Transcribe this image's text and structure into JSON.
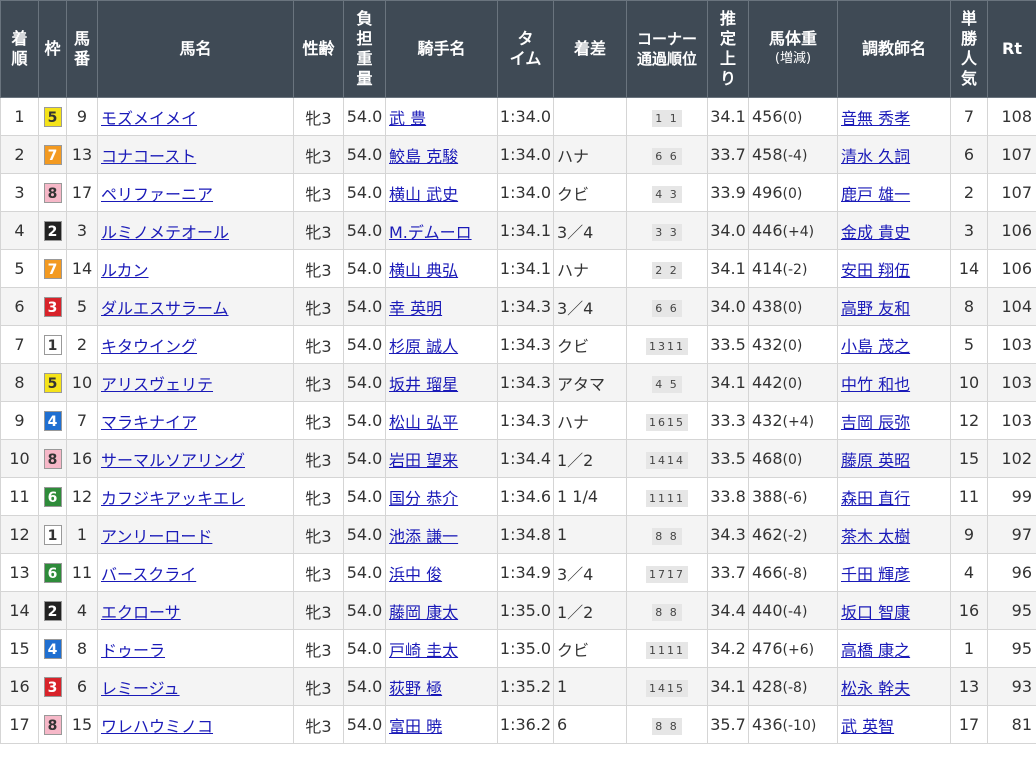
{
  "header": {
    "finish": "着順",
    "waku": "枠",
    "umaban": "馬番",
    "horse": "馬名",
    "sexage": "性齢",
    "weight": "負担重量",
    "jockey": "騎手名",
    "time": "タイム",
    "margin": "着差",
    "corner": "コーナー通過順位",
    "last3f": "推定上り",
    "body": "馬体重",
    "body_sub": "(増減)",
    "trainer": "調教師名",
    "pop": "単勝人気",
    "rt": "Rt"
  },
  "colors": {
    "1": {
      "bg": "#ffffff",
      "fg": "#333333"
    },
    "2": {
      "bg": "#222222",
      "fg": "#ffffff"
    },
    "3": {
      "bg": "#d8232a",
      "fg": "#ffffff"
    },
    "4": {
      "bg": "#1f6fd1",
      "fg": "#ffffff"
    },
    "5": {
      "bg": "#f5e31a",
      "fg": "#333333"
    },
    "6": {
      "bg": "#2e8b3a",
      "fg": "#ffffff"
    },
    "7": {
      "bg": "#f39a21",
      "fg": "#ffffff"
    },
    "8": {
      "bg": "#f6b8c8",
      "fg": "#333333"
    }
  },
  "rows": [
    {
      "finish": "1",
      "waku": "5",
      "umaban": "9",
      "horse": "モズメイメイ",
      "sexage": "牝3",
      "weight": "54.0",
      "jockey": "武 豊",
      "time": "1:34.0",
      "margin": "",
      "corner": "1 1",
      "last3f": "34.1",
      "body": "456",
      "diff": "(0)",
      "trainer": "音無 秀孝",
      "pop": "7",
      "rt": "108"
    },
    {
      "finish": "2",
      "waku": "7",
      "umaban": "13",
      "horse": "コナコースト",
      "sexage": "牝3",
      "weight": "54.0",
      "jockey": "鮫島 克駿",
      "time": "1:34.0",
      "margin": "ハナ",
      "corner": "6 6",
      "last3f": "33.7",
      "body": "458",
      "diff": "(-4)",
      "trainer": "清水 久詞",
      "pop": "6",
      "rt": "107"
    },
    {
      "finish": "3",
      "waku": "8",
      "umaban": "17",
      "horse": "ペリファーニア",
      "sexage": "牝3",
      "weight": "54.0",
      "jockey": "横山 武史",
      "time": "1:34.0",
      "margin": "クビ",
      "corner": "4 3",
      "last3f": "33.9",
      "body": "496",
      "diff": "(0)",
      "trainer": "鹿戸 雄一",
      "pop": "2",
      "rt": "107"
    },
    {
      "finish": "4",
      "waku": "2",
      "umaban": "3",
      "horse": "ルミノメテオール",
      "sexage": "牝3",
      "weight": "54.0",
      "jockey": "M.デムーロ",
      "time": "1:34.1",
      "margin": "3／4",
      "corner": "3 3",
      "last3f": "34.0",
      "body": "446",
      "diff": "(+4)",
      "trainer": "金成 貴史",
      "pop": "3",
      "rt": "106"
    },
    {
      "finish": "5",
      "waku": "7",
      "umaban": "14",
      "horse": "ルカン",
      "sexage": "牝3",
      "weight": "54.0",
      "jockey": "横山 典弘",
      "time": "1:34.1",
      "margin": "ハナ",
      "corner": "2 2",
      "last3f": "34.1",
      "body": "414",
      "diff": "(-2)",
      "trainer": "安田 翔伍",
      "pop": "14",
      "rt": "106"
    },
    {
      "finish": "6",
      "waku": "3",
      "umaban": "5",
      "horse": "ダルエスサラーム",
      "sexage": "牝3",
      "weight": "54.0",
      "jockey": "幸 英明",
      "time": "1:34.3",
      "margin": "3／4",
      "corner": "6 6",
      "last3f": "34.0",
      "body": "438",
      "diff": "(0)",
      "trainer": "高野 友和",
      "pop": "8",
      "rt": "104"
    },
    {
      "finish": "7",
      "waku": "1",
      "umaban": "2",
      "horse": "キタウイング",
      "sexage": "牝3",
      "weight": "54.0",
      "jockey": "杉原 誠人",
      "time": "1:34.3",
      "margin": "クビ",
      "corner": "1311",
      "last3f": "33.5",
      "body": "432",
      "diff": "(0)",
      "trainer": "小島 茂之",
      "pop": "5",
      "rt": "103"
    },
    {
      "finish": "8",
      "waku": "5",
      "umaban": "10",
      "horse": "アリスヴェリテ",
      "sexage": "牝3",
      "weight": "54.0",
      "jockey": "坂井 瑠星",
      "time": "1:34.3",
      "margin": "アタマ",
      "corner": "4 5",
      "last3f": "34.1",
      "body": "442",
      "diff": "(0)",
      "trainer": "中竹 和也",
      "pop": "10",
      "rt": "103"
    },
    {
      "finish": "9",
      "waku": "4",
      "umaban": "7",
      "horse": "マラキナイア",
      "sexage": "牝3",
      "weight": "54.0",
      "jockey": "松山 弘平",
      "time": "1:34.3",
      "margin": "ハナ",
      "corner": "1615",
      "last3f": "33.3",
      "body": "432",
      "diff": "(+4)",
      "trainer": "吉岡 辰弥",
      "pop": "12",
      "rt": "103"
    },
    {
      "finish": "10",
      "waku": "8",
      "umaban": "16",
      "horse": "サーマルソアリング",
      "sexage": "牝3",
      "weight": "54.0",
      "jockey": "岩田 望来",
      "time": "1:34.4",
      "margin": "1／2",
      "corner": "1414",
      "last3f": "33.5",
      "body": "468",
      "diff": "(0)",
      "trainer": "藤原 英昭",
      "pop": "15",
      "rt": "102"
    },
    {
      "finish": "11",
      "waku": "6",
      "umaban": "12",
      "horse": "カフジキアッキエレ",
      "sexage": "牝3",
      "weight": "54.0",
      "jockey": "国分 恭介",
      "time": "1:34.6",
      "margin": "1 1/4",
      "corner": "1111",
      "last3f": "33.8",
      "body": "388",
      "diff": "(-6)",
      "trainer": "森田 直行",
      "pop": "11",
      "rt": "99"
    },
    {
      "finish": "12",
      "waku": "1",
      "umaban": "1",
      "horse": "アンリーロード",
      "sexage": "牝3",
      "weight": "54.0",
      "jockey": "池添 謙一",
      "time": "1:34.8",
      "margin": "1",
      "corner": "8 8",
      "last3f": "34.3",
      "body": "462",
      "diff": "(-2)",
      "trainer": "茶木 太樹",
      "pop": "9",
      "rt": "97"
    },
    {
      "finish": "13",
      "waku": "6",
      "umaban": "11",
      "horse": "バースクライ",
      "sexage": "牝3",
      "weight": "54.0",
      "jockey": "浜中 俊",
      "time": "1:34.9",
      "margin": "3／4",
      "corner": "1717",
      "last3f": "33.7",
      "body": "466",
      "diff": "(-8)",
      "trainer": "千田 輝彦",
      "pop": "4",
      "rt": "96"
    },
    {
      "finish": "14",
      "waku": "2",
      "umaban": "4",
      "horse": "エクローサ",
      "sexage": "牝3",
      "weight": "54.0",
      "jockey": "藤岡 康太",
      "time": "1:35.0",
      "margin": "1／2",
      "corner": "8 8",
      "last3f": "34.4",
      "body": "440",
      "diff": "(-4)",
      "trainer": "坂口 智康",
      "pop": "16",
      "rt": "95"
    },
    {
      "finish": "15",
      "waku": "4",
      "umaban": "8",
      "horse": "ドゥーラ",
      "sexage": "牝3",
      "weight": "54.0",
      "jockey": "戸崎 圭太",
      "time": "1:35.0",
      "margin": "クビ",
      "corner": "1111",
      "last3f": "34.2",
      "body": "476",
      "diff": "(+6)",
      "trainer": "高橋 康之",
      "pop": "1",
      "rt": "95"
    },
    {
      "finish": "16",
      "waku": "3",
      "umaban": "6",
      "horse": "レミージュ",
      "sexage": "牝3",
      "weight": "54.0",
      "jockey": "荻野 極",
      "time": "1:35.2",
      "margin": "1",
      "corner": "1415",
      "last3f": "34.1",
      "body": "428",
      "diff": "(-8)",
      "trainer": "松永 幹夫",
      "pop": "13",
      "rt": "93"
    },
    {
      "finish": "17",
      "waku": "8",
      "umaban": "15",
      "horse": "ワレハウミノコ",
      "sexage": "牝3",
      "weight": "54.0",
      "jockey": "富田 暁",
      "time": "1:36.2",
      "margin": "6",
      "corner": "8 8",
      "last3f": "35.7",
      "body": "436",
      "diff": "(-10)",
      "trainer": "武 英智",
      "pop": "17",
      "rt": "81"
    }
  ]
}
